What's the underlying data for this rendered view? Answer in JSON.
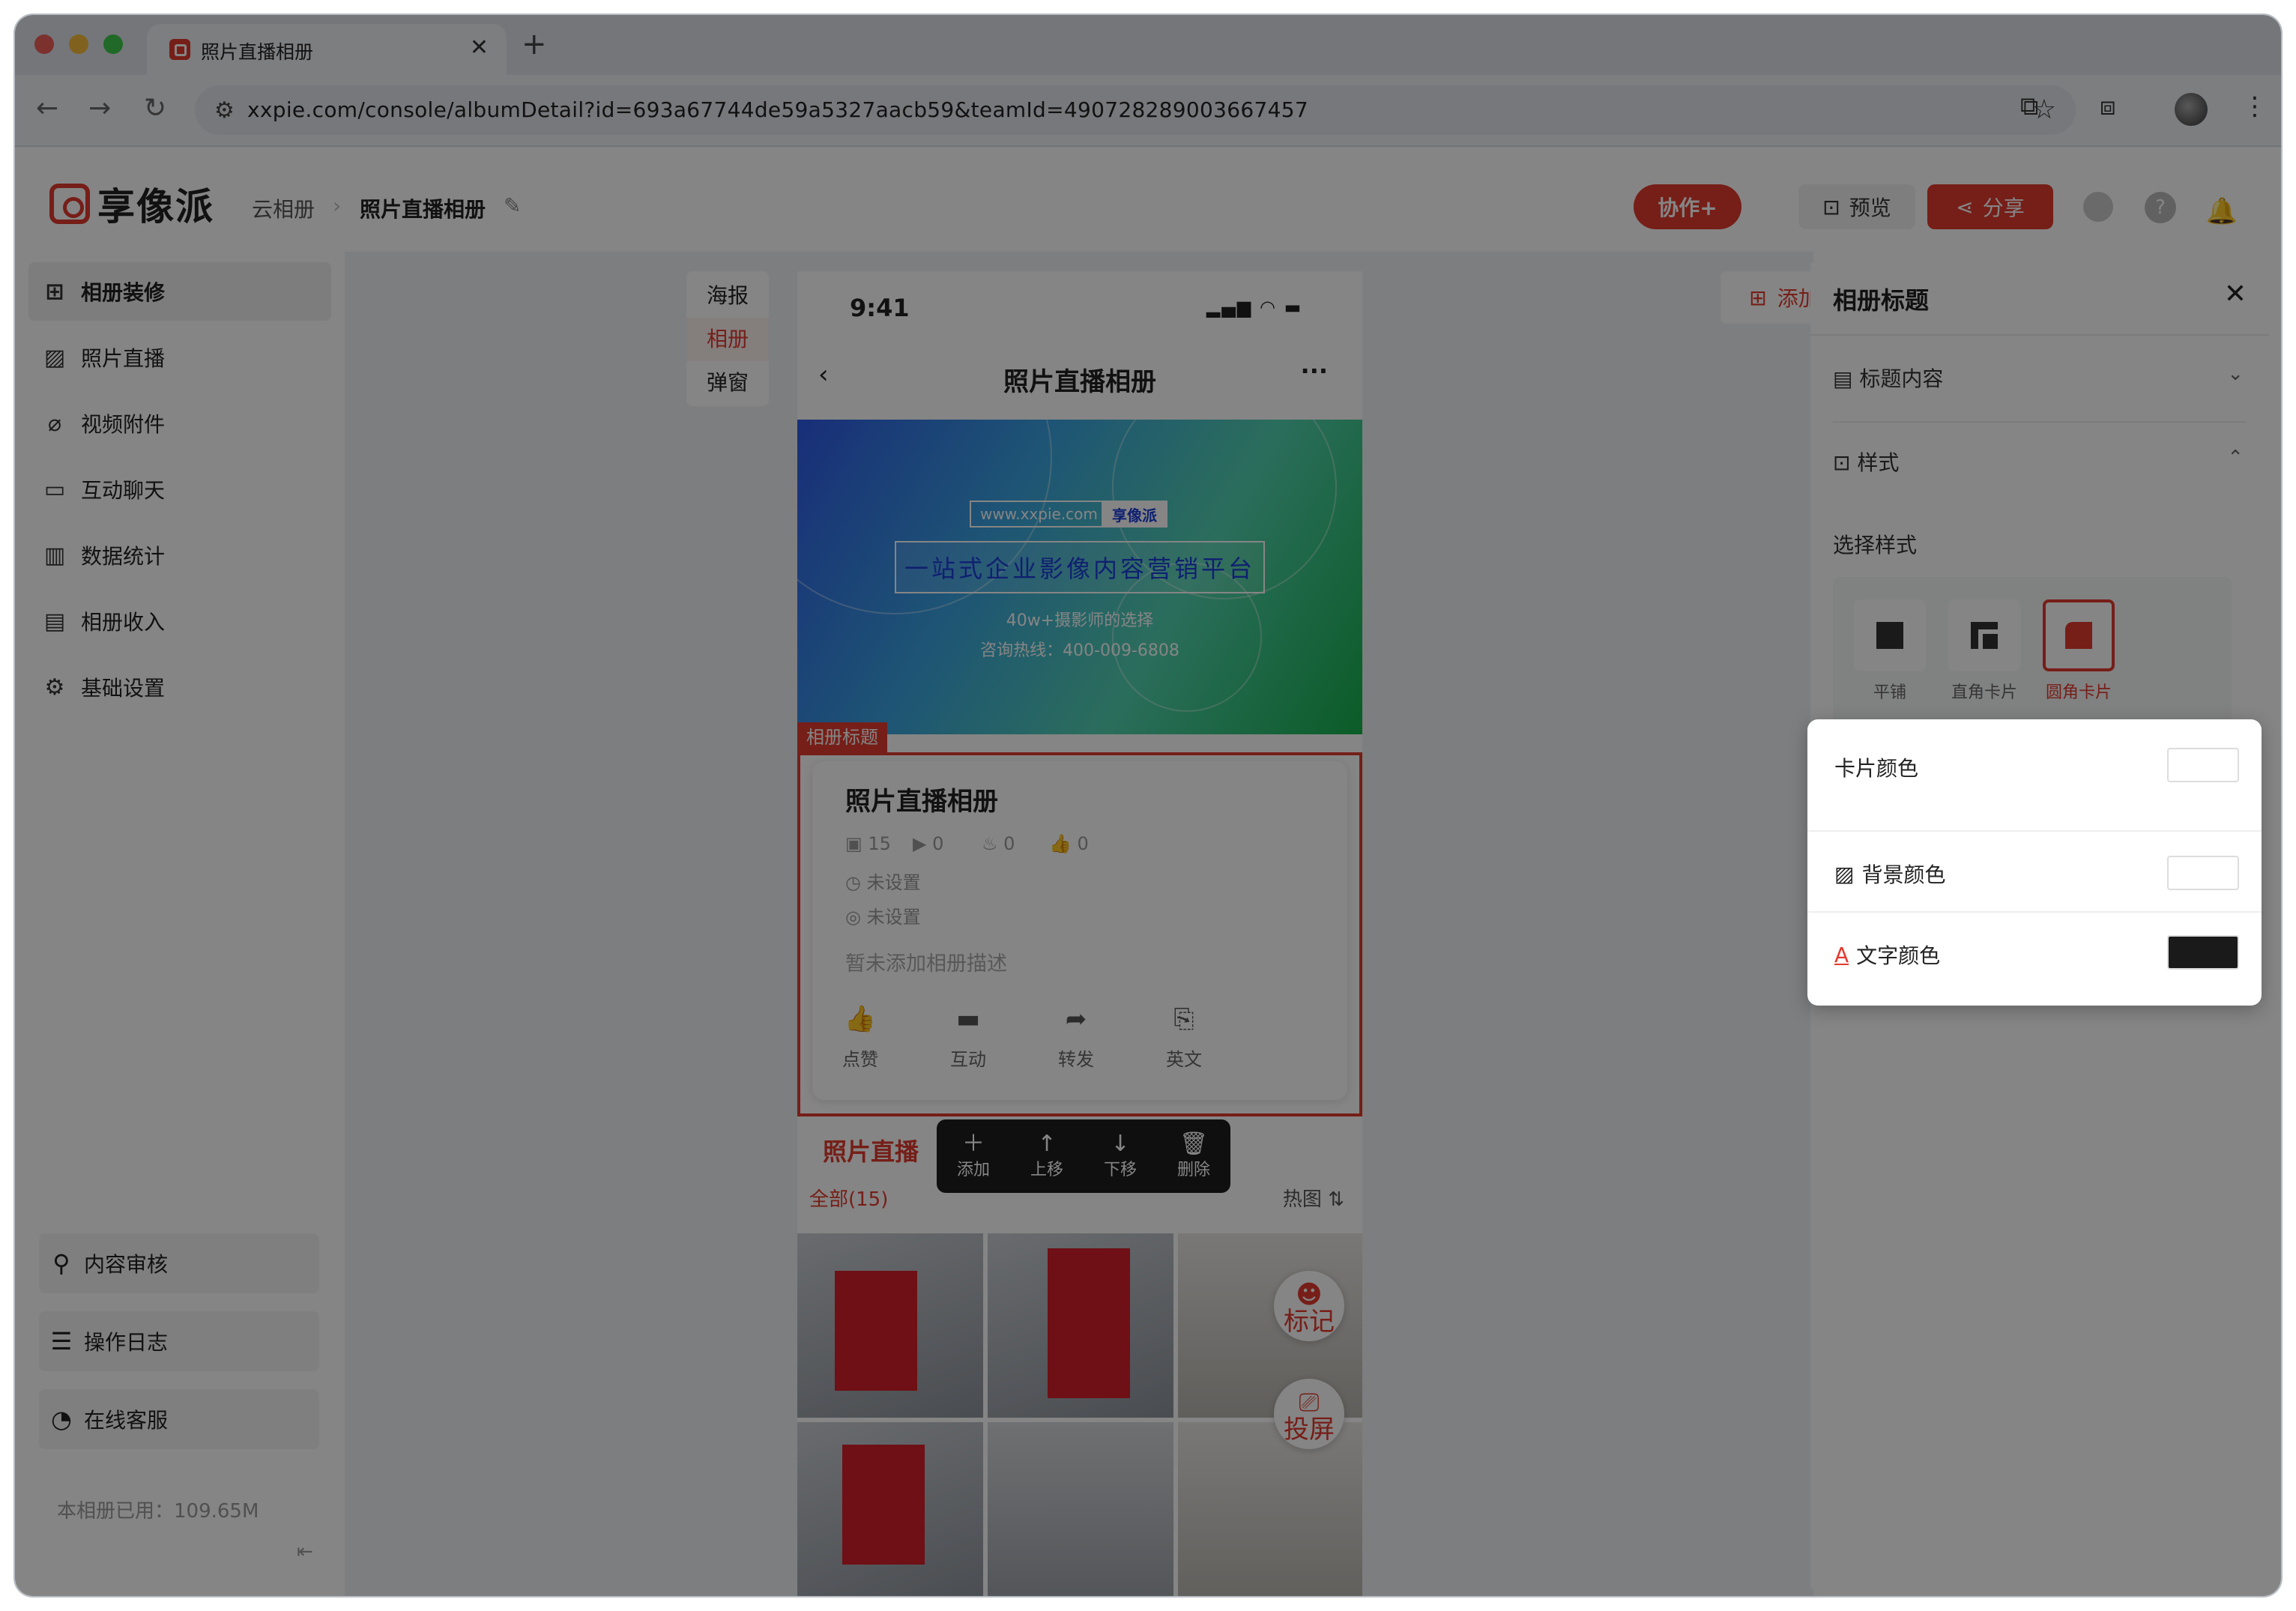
{
  "browser": {
    "tab_title": "照片直播相册",
    "url": "xxpie.com/console/albumDetail?id=693a67744de59a5327aacb59&teamId=490728289003667457"
  },
  "header": {
    "logo_text": "享像派",
    "breadcrumb_root": "云相册",
    "breadcrumb_current": "照片直播相册",
    "collab_label": "协作+",
    "preview_label": "预览",
    "share_label": "分享"
  },
  "sidebar": {
    "items": [
      {
        "label": "相册装修",
        "icon": "decorate-icon"
      },
      {
        "label": "照片直播",
        "icon": "image-icon"
      },
      {
        "label": "视频附件",
        "icon": "paperclip-icon"
      },
      {
        "label": "互动聊天",
        "icon": "chat-icon"
      },
      {
        "label": "数据统计",
        "icon": "chart-icon"
      },
      {
        "label": "相册收入",
        "icon": "income-icon"
      },
      {
        "label": "基础设置",
        "icon": "gear-icon"
      }
    ],
    "bottom_items": [
      {
        "label": "内容审核",
        "icon": "audit-icon"
      },
      {
        "label": "操作日志",
        "icon": "log-icon"
      },
      {
        "label": "在线客服",
        "icon": "headset-icon"
      }
    ],
    "storage_used": "本相册已用：109.65M"
  },
  "canvas": {
    "vtabs": [
      "海报",
      "相册",
      "弹窗"
    ],
    "active_vtab": "相册",
    "add_component": "添加组件"
  },
  "phone": {
    "time": "9:41",
    "title": "照片直播相册",
    "banner": {
      "site": "www.xxpie.com",
      "brand": "享像派",
      "slogan": "一站式企业影像内容营销平台",
      "line1": "40w+摄影师的选择",
      "line2": "咨询热线：400-009-6808"
    },
    "selected_tag": "相册标题",
    "card": {
      "title": "照片直播相册",
      "stats": [
        "15",
        "0",
        "0",
        "0"
      ],
      "time": "未设置",
      "location": "未设置",
      "description": "暂未添加相册描述",
      "actions": [
        "点赞",
        "互动",
        "转发",
        "英文"
      ]
    },
    "section_title": "照片直播",
    "toolbar": [
      "添加",
      "上移",
      "下移",
      "删除"
    ],
    "filter_all": "全部(15)",
    "filter_hot": "热图",
    "fab_mark": "标记",
    "fab_cast": "投屏"
  },
  "right_panel": {
    "title": "相册标题",
    "title_content": "标题内容",
    "style": "样式",
    "choose_style": "选择样式",
    "style_options": [
      "平铺",
      "直角卡片",
      "圆角卡片"
    ],
    "active_style": "圆角卡片"
  },
  "color_popup": {
    "card_color": "卡片颜色",
    "bg_color": "背景颜色",
    "text_color": "文字颜色",
    "card_color_value": "#ffffff",
    "bg_color_value": "#ffffff",
    "text_color_value": "#1a1a1a"
  }
}
